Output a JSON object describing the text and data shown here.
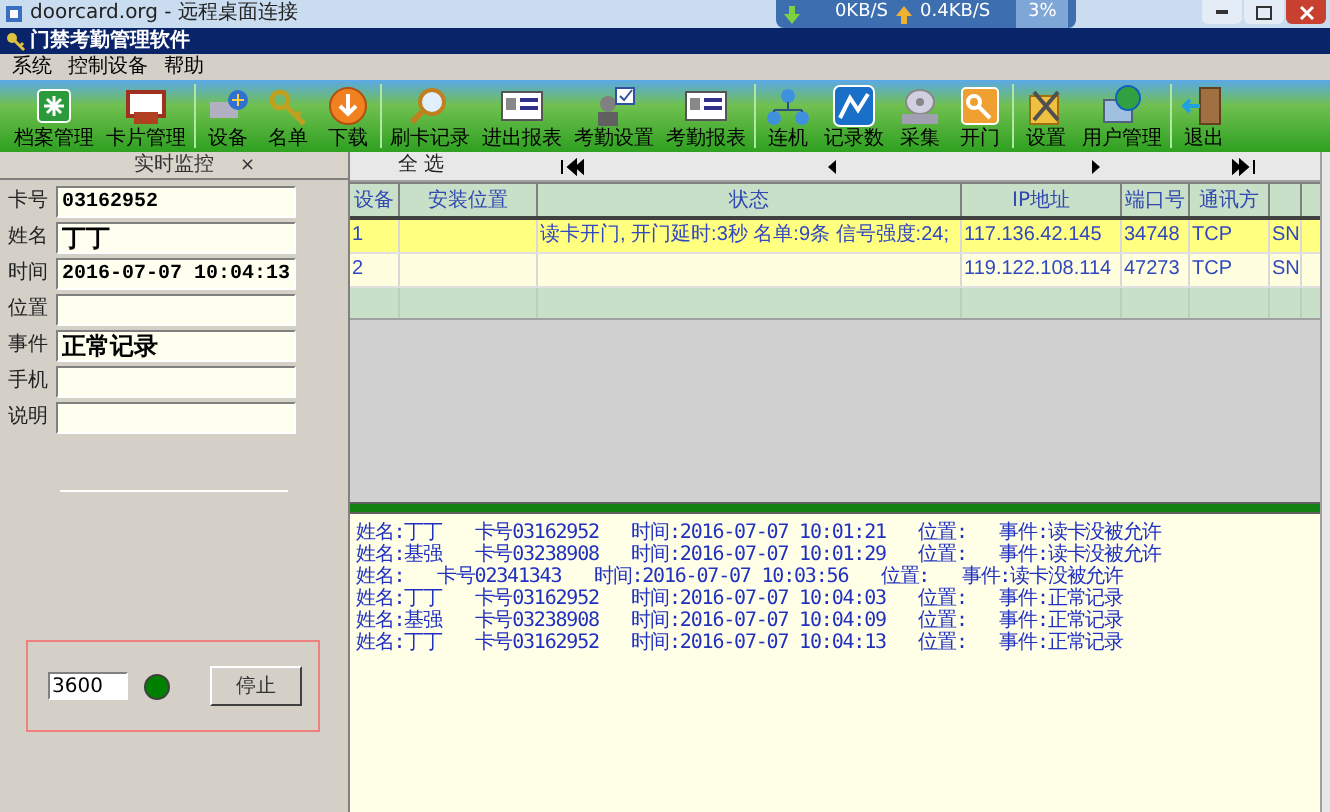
{
  "remote_bar": {
    "title": "doorcard.org - 远程桌面连接",
    "download": "0KB/S",
    "upload": "0.4KB/S",
    "cpu": "3%"
  },
  "window": {
    "title": "门禁考勤管理软件"
  },
  "menu": [
    "系统",
    "控制设备",
    "帮助"
  ],
  "toolbar": [
    [
      "档案管理",
      "卡片管理"
    ],
    [
      "设备",
      "名单",
      "下载"
    ],
    [
      "刷卡记录",
      "进出报表",
      "考勤设置",
      "考勤报表"
    ],
    [
      "连机",
      "记录数",
      "采集",
      "开门"
    ],
    [
      "设置",
      "用户管理"
    ],
    [
      "退出"
    ]
  ],
  "monitor": {
    "title": "实时监控",
    "close": "×",
    "fields": [
      {
        "label": "卡号",
        "value": "03162952",
        "kind": "mono"
      },
      {
        "label": "姓名",
        "value": "丁丁",
        "kind": "bold"
      },
      {
        "label": "时间",
        "value": "2016-07-07 10:04:13",
        "kind": "mono"
      },
      {
        "label": "位置",
        "kind": "mono"
      },
      {
        "label": "事件",
        "value": "正常记录",
        "kind": "bold"
      },
      {
        "label": "手机",
        "kind": "mono"
      },
      {
        "label": "说明",
        "kind": "mono"
      }
    ],
    "interval": "3600",
    "running": true,
    "stop_button": "停止"
  },
  "nav": {
    "select_all": "全 选"
  },
  "table": {
    "columns": [
      "设备",
      "安装位置",
      "状态",
      "IP地址",
      "端口号",
      "通讯方"
    ],
    "rows": [
      {
        "selected": true,
        "cells": [
          "1",
          "",
          "读卡开门, 开门延时:3秒 名单:9条 信号强度:24;",
          "117.136.42.145",
          "34748",
          "TCP",
          "SN"
        ]
      },
      {
        "selected": false,
        "cells": [
          "2",
          "",
          "",
          "119.122.108.114",
          "47273",
          "TCP",
          "SN"
        ]
      }
    ]
  },
  "log": [
    "姓名:丁丁   卡号03162952   时间:2016-07-07 10:01:21   位置:   事件:读卡没被允许",
    "姓名:基强   卡号03238908   时间:2016-07-07 10:01:29   位置:   事件:读卡没被允许",
    "姓名:   卡号02341343   时间:2016-07-07 10:03:56   位置:   事件:读卡没被允许",
    "姓名:丁丁   卡号03162952   时间:2016-07-07 10:04:03   位置:   事件:正常记录",
    "姓名:基强   卡号03238908   时间:2016-07-07 10:04:09   位置:   事件:正常记录",
    "姓名:丁丁   卡号03162952   时间:2016-07-07 10:04:13   位置:   事件:正常记录"
  ]
}
